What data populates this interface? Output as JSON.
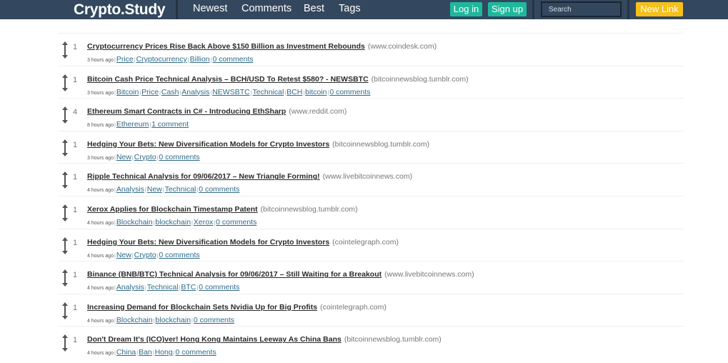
{
  "header": {
    "brand": "Crypto.Study",
    "nav": [
      "Newest",
      "Comments",
      "Best",
      "Tags"
    ],
    "login_label": "Log in",
    "signup_label": "Sign up",
    "search_placeholder": "Search",
    "new_link_label": "New Link"
  },
  "colors": {
    "header_bg": "#33485e",
    "accent_green": "#1fb89c",
    "accent_yellow": "#f6c019"
  },
  "stories": [
    {
      "score": "1",
      "title": "Cryptocurrency Prices Rise Back Above $150 Billion as Investment Rebounds",
      "domain": "(www.coindesk.com)",
      "time": "3 hours ago",
      "tags": [
        "Price",
        "Cryptocurrency",
        "Billion"
      ],
      "comments": "0 comments"
    },
    {
      "score": "1",
      "title": "Bitcoin Cash Price Technical Analysis – BCH/USD To Retest $580? - NEWSBTC",
      "domain": "(bitcoinnewsblog.tumblr.com)",
      "time": "3 hours ago",
      "tags": [
        "Bitcoin",
        "Price",
        "Cash",
        "Analysis",
        "NEWSBTC",
        "Technical",
        "BCH",
        "bitcoin"
      ],
      "comments": "0 comments"
    },
    {
      "score": "4",
      "title": "Ethereum Smart Contracts in C# - Introducing EthSharp",
      "domain": "(www.reddit.com)",
      "time": "8 hours ago",
      "tags": [
        "Ethereum"
      ],
      "comments": "1 comment"
    },
    {
      "score": "1",
      "title": "Hedging Your Bets: New Diversification Models for Crypto Investors",
      "domain": "(bitcoinnewsblog.tumblr.com)",
      "time": "3 hours ago",
      "tags": [
        "New",
        "Crypto"
      ],
      "comments": "0 comments"
    },
    {
      "score": "1",
      "title": "Ripple Technical Analysis for 09/06/2017 – New Triangle Forming!",
      "domain": "(www.livebitcoinnews.com)",
      "time": "4 hours ago",
      "tags": [
        "Analysis",
        "New",
        "Technical"
      ],
      "comments": "0 comments"
    },
    {
      "score": "1",
      "title": "Xerox Applies for Blockchain Timestamp Patent",
      "domain": "(bitcoinnewsblog.tumblr.com)",
      "time": "4 hours ago",
      "tags": [
        "Blockchain",
        "blockchain",
        "Xerox"
      ],
      "comments": "0 comments"
    },
    {
      "score": "1",
      "title": "Hedging Your Bets: New Diversification Models for Crypto Investors",
      "domain": "(cointelegraph.com)",
      "time": "4 hours ago",
      "tags": [
        "New",
        "Crypto"
      ],
      "comments": "0 comments"
    },
    {
      "score": "1",
      "title": "Binance (BNB/BTC) Technical Analysis for 09/06/2017 – Still Waiting for a Breakout",
      "domain": "(www.livebitcoinnews.com)",
      "time": "4 hours ago",
      "tags": [
        "Analysis",
        "Technical",
        "BTC"
      ],
      "comments": "0 comments"
    },
    {
      "score": "1",
      "title": "Increasing Demand for Blockchain Sets Nvidia Up for Big Profits",
      "domain": "(cointelegraph.com)",
      "time": "4 hours ago",
      "tags": [
        "Blockchain",
        "blockchain"
      ],
      "comments": "0 comments"
    },
    {
      "score": "1",
      "title": "Don't Dream It's (ICO)ver! Hong Kong Maintains Leeway As China Bans",
      "domain": "(bitcoinnewsblog.tumblr.com)",
      "time": "4 hours ago",
      "tags": [
        "China",
        "Ban",
        "Hong"
      ],
      "comments": "0 comments"
    }
  ]
}
